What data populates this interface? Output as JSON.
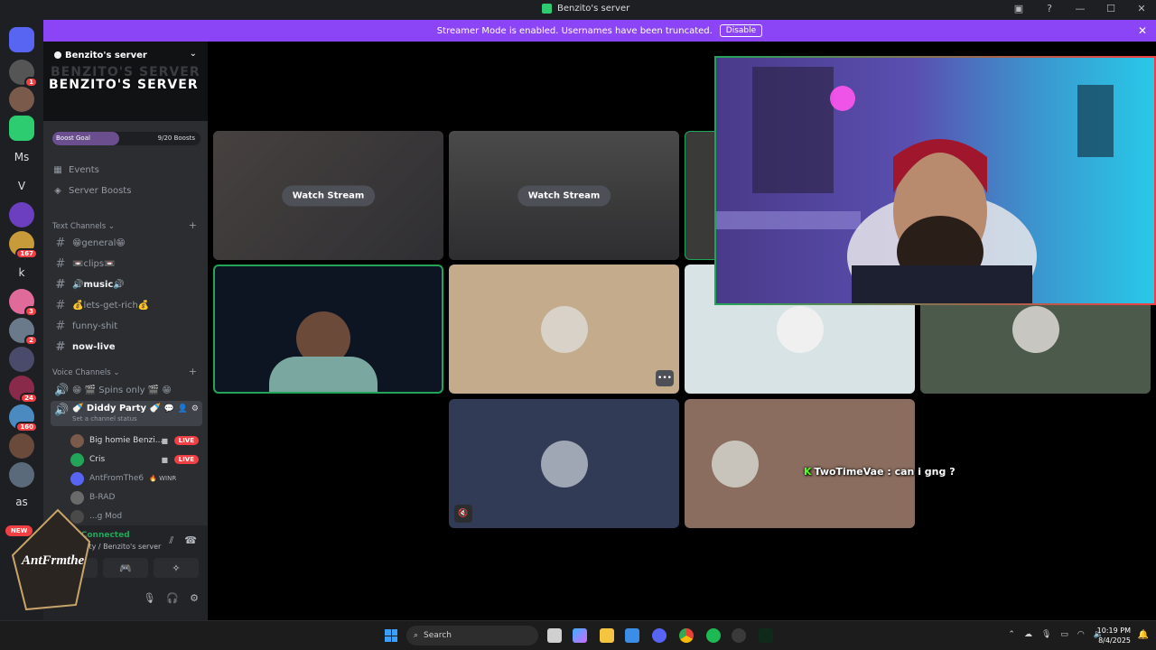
{
  "window": {
    "title": "Benzito's server"
  },
  "banner": {
    "text": "Streamer Mode is enabled. Usernames have been truncated.",
    "button": "Disable"
  },
  "guilds": [
    {
      "label": "",
      "badge": "1"
    },
    {
      "label": "",
      "badge": ""
    },
    {
      "label": "",
      "badge": ""
    },
    {
      "label": "Ms",
      "badge": ""
    },
    {
      "label": "V",
      "badge": ""
    },
    {
      "label": "",
      "badge": ""
    },
    {
      "label": "",
      "badge": "167"
    },
    {
      "label": "k",
      "badge": ""
    },
    {
      "label": "",
      "badge": "3"
    },
    {
      "label": "",
      "badge": "2"
    },
    {
      "label": "",
      "badge": ""
    },
    {
      "label": "",
      "badge": "24"
    },
    {
      "label": "",
      "badge": "160"
    },
    {
      "label": "",
      "badge": ""
    },
    {
      "label": "",
      "badge": ""
    },
    {
      "label": "as",
      "badge": ""
    }
  ],
  "new_badge": "NEW",
  "server": {
    "name": "Benzito's server",
    "banner_title": "BENZITO'S SERVER",
    "boost_goal": "Boost Goal",
    "boosts": "9/20 Boosts",
    "boost_fraction": 0.45,
    "events": "Events",
    "server_boosts": "Server Boosts"
  },
  "text_category": "Text Channels",
  "text_channels": [
    {
      "name": "😁general😁",
      "bold": false
    },
    {
      "name": "📼clips📼",
      "bold": false
    },
    {
      "name": "🔊music🔊",
      "bold": true
    },
    {
      "name": "💰lets-get-rich💰",
      "bold": false
    },
    {
      "name": "funny-shit",
      "bold": false
    },
    {
      "name": "now-live",
      "bold": true
    }
  ],
  "voice_category": "Voice Channels",
  "voice_channels": [
    {
      "name": "😁 🎬 Spins only 🎬 😁"
    },
    {
      "name": "🍼 Diddy Party 🍼",
      "status": "Set a channel status"
    }
  ],
  "voice_users": [
    {
      "name": "Big homie Benzi...",
      "live": "LIVE",
      "cam": true
    },
    {
      "name": "Cris",
      "live": "LIVE",
      "cam": true
    },
    {
      "name": "AntFromThe6",
      "tag": "WINR"
    },
    {
      "name": "B-RAD"
    },
    {
      "name": "...g Mod"
    }
  ],
  "voice_panel": {
    "status": "Video Connected",
    "channel": "Diddy Party / Benzito's server"
  },
  "sticker_text": "AntFrmthe",
  "tiles": {
    "watch_label": "Watch Stream"
  },
  "caption": {
    "user": "TwoTimeVae",
    "text": " : can i gng ?"
  },
  "taskbar": {
    "search": "Search",
    "time": "10:19 PM",
    "date": "8/4/2025"
  },
  "colors": {
    "accent": "#8c44f7",
    "live": "#f23f43",
    "connected": "#23a559"
  }
}
